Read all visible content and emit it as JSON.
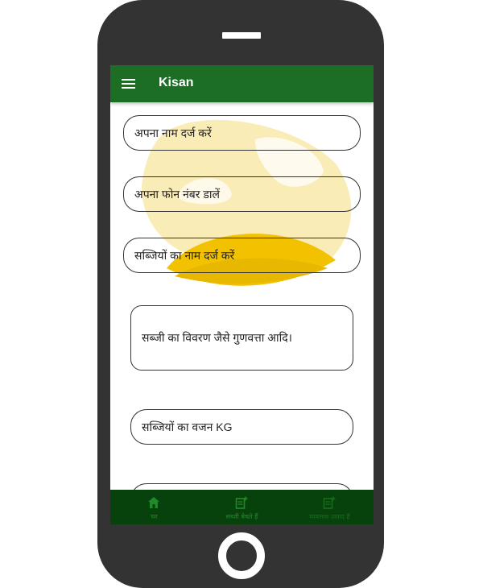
{
  "app": {
    "title": "Kisan",
    "menu_icon": "menu-icon"
  },
  "colors": {
    "appbar": "#1b6e24",
    "bottom_nav": "#07410b",
    "watermark_yellow": "#f2c200",
    "phone_body": "#333333"
  },
  "form": {
    "name_placeholder": "अपना नाम दर्ज करें",
    "phone_placeholder": "अपना फोन नंबर डालें",
    "vegetable_placeholder": "सब्जियों का नाम दर्ज करें",
    "description_placeholder": "सब्जी का विवरण जैसे गुणवत्ता आदि।",
    "weight_placeholder": "सब्जियों का वजन KG"
  },
  "bottom_nav": {
    "items": [
      {
        "label": "घर",
        "icon": "home-icon"
      },
      {
        "label": "सब्जी बेचते हैं",
        "icon": "add-note-icon"
      },
      {
        "label": "व्यवसाय उत्पाद है",
        "icon": "add-note-icon"
      }
    ]
  }
}
